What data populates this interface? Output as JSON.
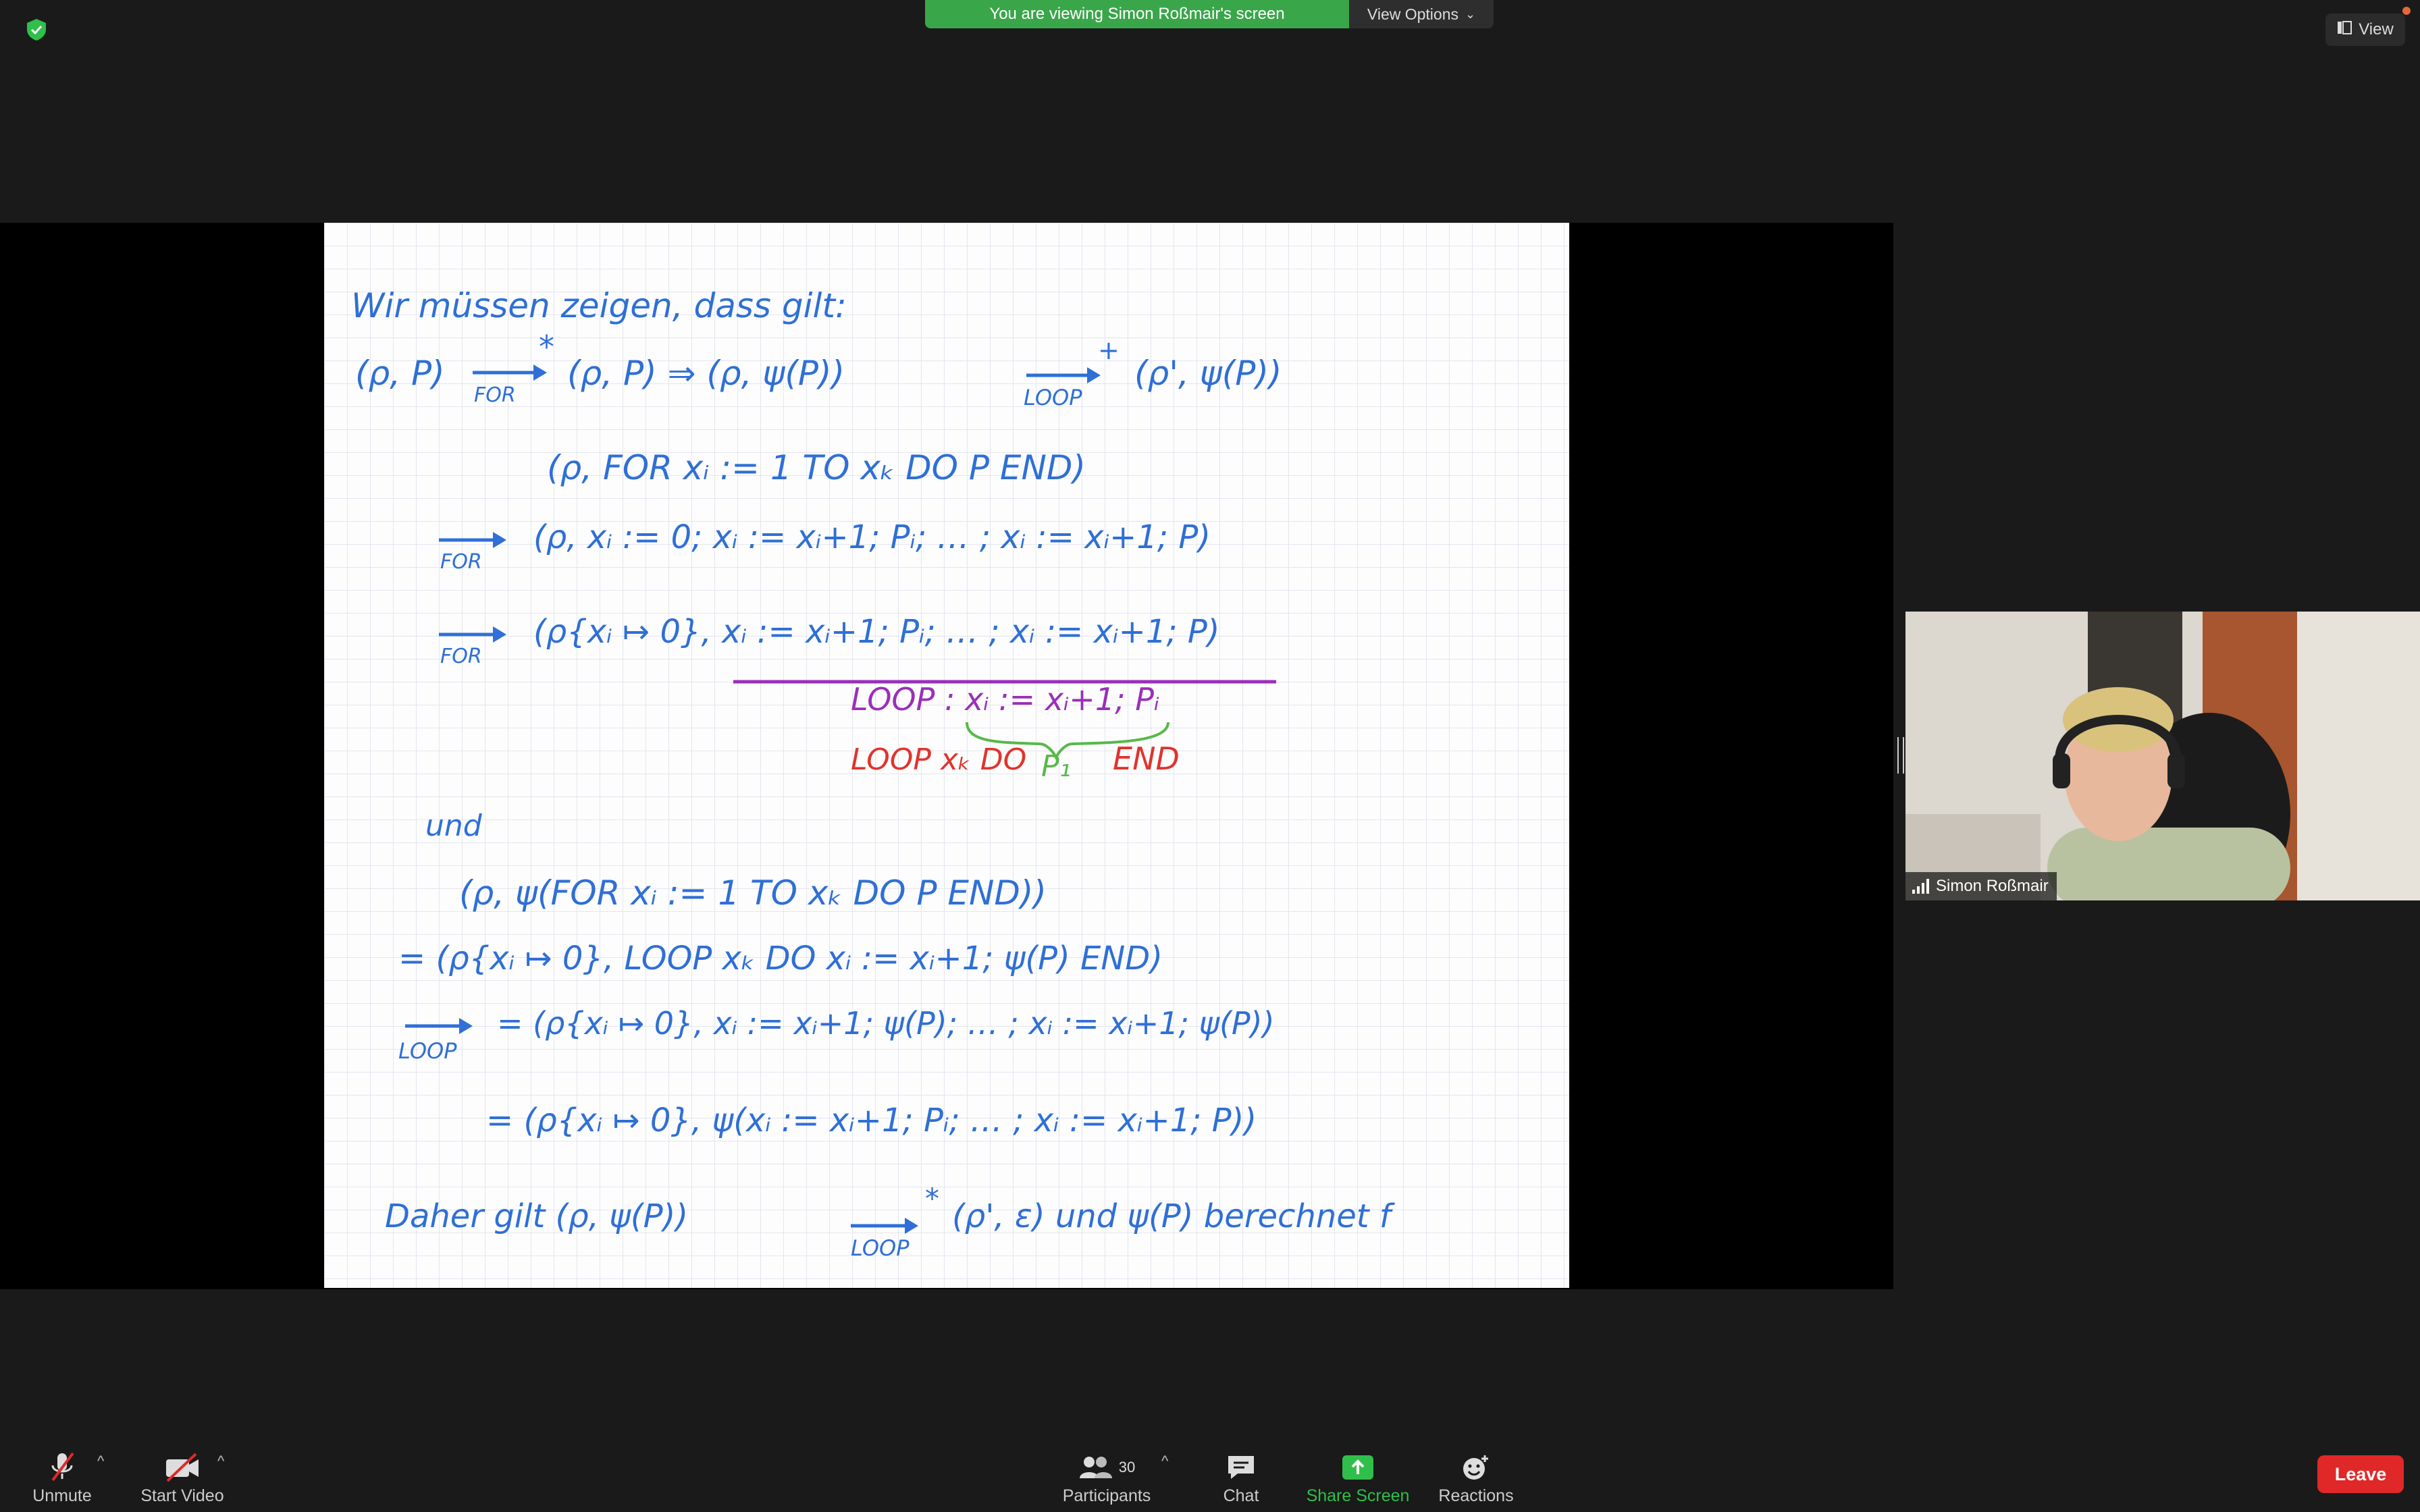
{
  "banner": {
    "text": "You are viewing Simon Roßmair's screen",
    "view_options": "View Options"
  },
  "top_right": {
    "view_label": "View"
  },
  "notebook": {
    "lines": [
      {
        "text": "Wir müssen zeigen, dass gilt:",
        "color": "#2f6fd6"
      },
      {
        "text": "(ρ, P)",
        "color": "#2f6fd6"
      },
      {
        "text": "(ρ, P)  ⇒  (ρ, ψ(P))",
        "color": "#2f6fd6"
      },
      {
        "text": "(ρ', ψ(P))",
        "color": "#2f6fd6"
      },
      {
        "text": "FOR",
        "color": "#2f6fd6"
      },
      {
        "text": "LOOP",
        "color": "#2f6fd6"
      },
      {
        "text": "(ρ, FOR  xᵢ := 1  TO  xₖ  DO P  END)",
        "color": "#2f6fd6"
      },
      {
        "text": "(ρ, xᵢ := 0; xᵢ := xᵢ+1; Pᵢ; … ; xᵢ := xᵢ+1; P)",
        "color": "#2f6fd6"
      },
      {
        "text": "(ρ{xᵢ ↦ 0}, xᵢ := xᵢ+1; Pᵢ; … ; xᵢ := xᵢ+1; P)",
        "color": "#2f6fd6"
      },
      {
        "text": "LOOP : xᵢ := xᵢ+1; Pᵢ",
        "color": "#9a2fb8"
      },
      {
        "text": "LOOP  xₖ DO",
        "color": "#e0342c"
      },
      {
        "text": "P₁",
        "color": "#58b84a"
      },
      {
        "text": "END",
        "color": "#e0342c"
      },
      {
        "text": "und",
        "color": "#2f6fd6"
      },
      {
        "text": "(ρ, ψ(FOR xᵢ := 1 TO xₖ DO P END))",
        "color": "#2f6fd6"
      },
      {
        "text": "= (ρ{xᵢ ↦ 0}, LOOP xₖ DO xᵢ := xᵢ+1; ψ(P) END)",
        "color": "#2f6fd6"
      },
      {
        "text": "= (ρ{xᵢ ↦ 0}, xᵢ := xᵢ+1; ψ(P); … ; xᵢ := xᵢ+1; ψ(P))",
        "color": "#2f6fd6"
      },
      {
        "text": "= (ρ{xᵢ ↦ 0}, ψ(xᵢ := xᵢ+1; Pᵢ; … ; xᵢ := xᵢ+1; P))",
        "color": "#2f6fd6"
      },
      {
        "text": "Daher gilt  (ρ, ψ(P))",
        "color": "#2f6fd6"
      },
      {
        "text": "(ρ', ε)  und  ψ(P) berechnet f",
        "color": "#2f6fd6"
      }
    ],
    "marks": {
      "star": "*",
      "plus": "+"
    }
  },
  "participant": {
    "name": "Simon Roßmair"
  },
  "toolbar": {
    "unmute": "Unmute",
    "start_video": "Start Video",
    "participants": "Participants",
    "participants_count": "30",
    "chat": "Chat",
    "share_screen": "Share Screen",
    "reactions": "Reactions",
    "leave": "Leave"
  },
  "colors": {
    "banner_green": "#3aa64a",
    "share_green": "#2fbf4a",
    "leave_red": "#e02828",
    "ink_blue": "#2f6fd6"
  }
}
